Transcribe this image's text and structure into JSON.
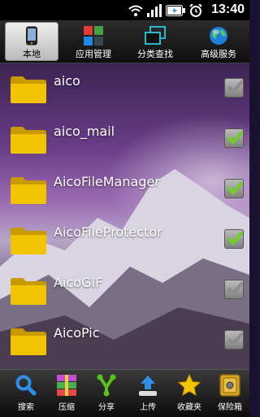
{
  "status_bar": {
    "time": "13:40",
    "icons": [
      "wifi-icon",
      "signal-icon",
      "battery-icon",
      "alarm-icon"
    ]
  },
  "tabs": [
    {
      "label": "本地",
      "icon": "phone-icon",
      "active": true
    },
    {
      "label": "应用管理",
      "icon": "apps-grid-icon",
      "active": false
    },
    {
      "label": "分类查找",
      "icon": "category-icon",
      "active": false
    },
    {
      "label": "高级服务",
      "icon": "globe-icon",
      "active": false
    }
  ],
  "files": [
    {
      "name": "aico",
      "checked": false
    },
    {
      "name": "aico_mail",
      "checked": true
    },
    {
      "name": "AicoFileManager",
      "checked": true
    },
    {
      "name": "AicoFileProtector",
      "checked": true
    },
    {
      "name": "AicoGIF",
      "checked": false
    },
    {
      "name": "AicoPic",
      "checked": false
    }
  ],
  "toolbar": [
    {
      "label": "搜索",
      "icon": "search-icon"
    },
    {
      "label": "压缩",
      "icon": "compress-icon"
    },
    {
      "label": "分享",
      "icon": "share-icon"
    },
    {
      "label": "上传",
      "icon": "upload-icon"
    },
    {
      "label": "收藏夹",
      "icon": "star-icon"
    },
    {
      "label": "保险箱",
      "icon": "safe-icon"
    }
  ],
  "colors": {
    "folder": "#f2c300",
    "check_on": "#6fcf1f",
    "accent_blue": "#2f8fe8"
  }
}
